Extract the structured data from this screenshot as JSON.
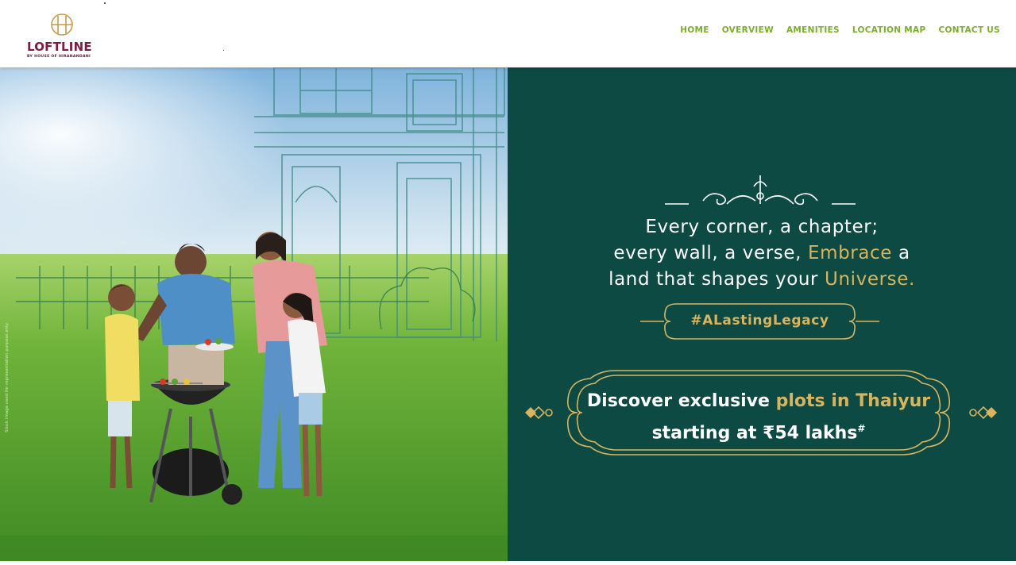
{
  "brand": {
    "name": "LOFTLINE",
    "tagline": "BY HOUSE OF HIRANANDANI",
    "colors": {
      "primary": "#7b1c43",
      "logo_mark": "#c89a4a"
    }
  },
  "nav": {
    "items": [
      {
        "label": "HOME"
      },
      {
        "label": "OVERVIEW"
      },
      {
        "label": "AMENITIES"
      },
      {
        "label": "LOCATION MAP"
      },
      {
        "label": "CONTACT US"
      }
    ],
    "color": "#7cae2b"
  },
  "hero": {
    "headline": {
      "line1": "Every corner, a chapter;",
      "line2_a": "every wall, a verse, ",
      "line2_gold": "Embrace",
      "line2_b": " a",
      "line3_a": "land that shapes your ",
      "line3_gold": "Universe."
    },
    "hashtag": "#ALastingLegacy",
    "offer": {
      "line1_a": "Discover exclusive ",
      "line1_gold": "plots in Thaiyur",
      "line2": "starting at ₹54 lakhs",
      "line2_sup": "#"
    },
    "side_note": "Stock image used for representation purpose only",
    "colors": {
      "panel": "#0c4a43",
      "gold": "#d8b45e"
    }
  }
}
